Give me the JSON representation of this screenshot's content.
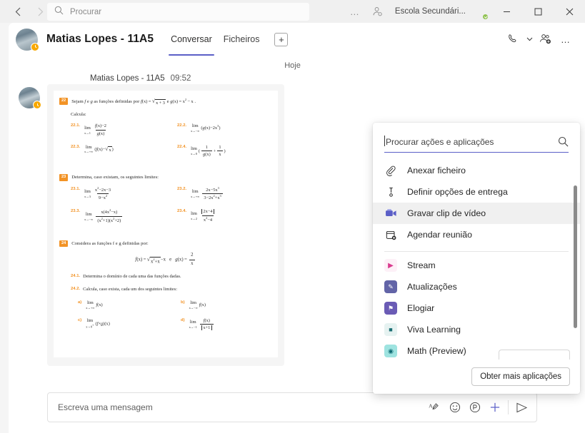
{
  "titlebar": {
    "back_icon": "chevron-left-icon",
    "forward_icon": "chevron-right-icon",
    "search_placeholder": "Procurar",
    "search_icon": "search-icon",
    "ellipsis": "…",
    "notification_icon": "person-alert-icon",
    "org_name": "Escola Secundári...",
    "avatar_name": "user-avatar",
    "presence": "available",
    "minimize": "─",
    "maximize": "☐",
    "close": "✕"
  },
  "chat_header": {
    "title": "Matias Lopes - 11A5",
    "presence": "away",
    "tabs": [
      {
        "label": "Conversar",
        "active": true
      },
      {
        "label": "Ficheiros",
        "active": false
      }
    ],
    "add_tab": "+",
    "call_icon": "phone-icon",
    "chevron": "⌄",
    "add_people_icon": "add-people-icon",
    "more_icon": "…"
  },
  "conversation": {
    "day_divider": "Hoje",
    "message": {
      "sender": "Matias Lopes - 11A5",
      "time": "09:52",
      "attachment_type": "worksheet-image"
    }
  },
  "worksheet": {
    "exercises": [
      {
        "number": "22",
        "statement": "Sejam f e g as funções definidas por f(x) = √x + 3 e g(x) = x² − x .",
        "second_line": "Calcula:",
        "items": [
          {
            "label": "22.1.",
            "expr": "lim x→1 (f(x)−2)/g(x)"
          },
          {
            "label": "22.2.",
            "expr": "lim x→−∞ (g(x) − 2x³)"
          },
          {
            "label": "22.3.",
            "expr": "lim x→+∞ (f(x) − √x)"
          },
          {
            "label": "22.4.",
            "expr": "lim x→0 (1/g(x) + 1/x)"
          }
        ]
      },
      {
        "number": "23",
        "statement": "Determina, caso existam, os seguintes limites:",
        "items": [
          {
            "label": "23.1.",
            "expr": "lim x→3 (x²−2x−3)/(9−x²)"
          },
          {
            "label": "23.2.",
            "expr": "lim x→+∞ (2x−5x³)/(3−2x²+x³)"
          },
          {
            "label": "23.3.",
            "expr": "lim x→−∞ x(4x²−x)/((x²+1)(x²+2))"
          },
          {
            "label": "23.4.",
            "expr": "lim x→2 |2x−4|/(x²−4)"
          }
        ]
      },
      {
        "number": "24",
        "statement": "Considera as funções f e g definidas por:",
        "equation": "f(x) = √(x² + x) − x    e    g(x) = 2/x",
        "items": [
          {
            "label": "24.1.",
            "expr": "Determina o domínio de cada uma das funções dadas."
          },
          {
            "label": "24.2.",
            "expr": "Calcula, caso exista, cada um dos seguintes limites:"
          }
        ],
        "subitems": [
          {
            "label": "a)",
            "expr": "lim x→+∞ f(x)"
          },
          {
            "label": "b)",
            "expr": "lim x→−∞ f(x)"
          },
          {
            "label": "c)",
            "expr": "lim x→0⁺ (f × g)(x)"
          },
          {
            "label": "d)",
            "expr": "lim x→−1 f(x)/|x+1|"
          }
        ]
      }
    ]
  },
  "compose": {
    "placeholder": "Escreva uma mensagem",
    "icons": [
      {
        "name": "format-icon",
        "glyph": "ᴬ∕"
      },
      {
        "name": "emoji-icon",
        "glyph": "☺"
      },
      {
        "name": "sticker-icon",
        "glyph": "Ⓟ"
      },
      {
        "name": "attach-plus-icon",
        "glyph": "＋"
      },
      {
        "name": "send-icon",
        "glyph": "➤"
      }
    ]
  },
  "panel": {
    "search_placeholder": "Procurar ações e aplicações",
    "search_icon": "search-icon",
    "actions": [
      {
        "label": "Anexar ficheiro",
        "icon": "paperclip-icon",
        "hovered": false
      },
      {
        "label": "Definir opções de entrega",
        "icon": "priority-icon",
        "hovered": false
      },
      {
        "label": "Gravar clip de vídeo",
        "icon": "video-camera-icon",
        "hovered": true
      },
      {
        "label": "Agendar reunião",
        "icon": "calendar-add-icon",
        "hovered": false
      }
    ],
    "apps": [
      {
        "label": "Stream",
        "icon": "stream-app-icon",
        "color": "#d93b8f",
        "bg": "#fdf0f7",
        "glyph": "▶"
      },
      {
        "label": "Atualizações",
        "icon": "updates-app-icon",
        "color": "#ffffff",
        "bg": "#6264a7",
        "glyph": "✎"
      },
      {
        "label": "Elogiar",
        "icon": "praise-app-icon",
        "color": "#ffffff",
        "bg": "#6a5bb5",
        "glyph": "⭐"
      },
      {
        "label": "Viva Learning",
        "icon": "viva-learning-app-icon",
        "color": "#1a6e73",
        "bg": "#e6f2f1",
        "glyph": "■"
      },
      {
        "label": "Math (Preview)",
        "icon": "math-app-icon",
        "color": "#0f6b74",
        "bg": "#9ee3e0",
        "glyph": "◉"
      }
    ],
    "footer_button": "Obter mais aplicações"
  }
}
